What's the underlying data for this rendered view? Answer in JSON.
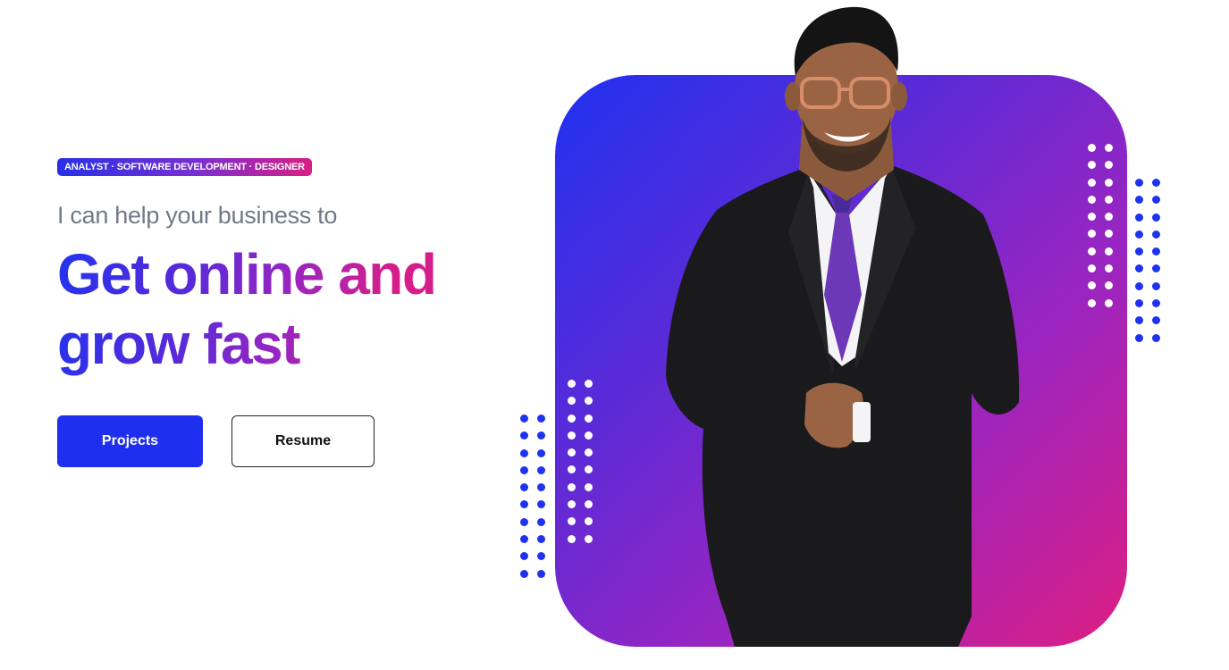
{
  "hero": {
    "badge": "ANALYST · SOFTWARE DEVELOPMENT · DESIGNER",
    "tagline": "I can help your business to",
    "headline_line1": "Get online and",
    "headline_line2": "grow fast",
    "buttons": {
      "primary_label": "Projects",
      "secondary_label": "Resume"
    }
  },
  "portrait": {
    "description": "person-in-suit",
    "icon": "person-portrait"
  },
  "colors": {
    "accent_blue": "#1f2ff0",
    "accent_purple": "#9b25c0",
    "accent_pink": "#dd1e82",
    "tagline_gray": "#707a88"
  }
}
